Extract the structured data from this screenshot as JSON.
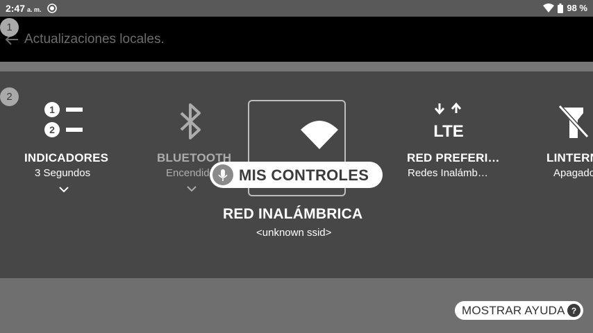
{
  "status_bar": {
    "time": "2:47",
    "ampm": "a. m.",
    "battery": "98 %"
  },
  "app_bar": {
    "title": "Actualizaciones locales."
  },
  "badges": [
    "1",
    "2"
  ],
  "controls": [
    {
      "label": "INDICADORES",
      "sub": "3 Segundos",
      "icon": "numbered-list-icon"
    },
    {
      "label": "BLUETOOTH",
      "sub": "Encendido",
      "icon": "bluetooth-icon"
    },
    {
      "label": "RED INALÁMBRICA",
      "sub": "<unknown ssid>",
      "icon": "wifi-icon"
    },
    {
      "label": "RED PREFERI…",
      "sub": "Redes Inalámb…",
      "icon": "lte-icon"
    },
    {
      "label": "LINTERNA",
      "sub": "Apagado",
      "icon": "flashlight-off-icon"
    }
  ],
  "overlay": {
    "title": "MIS CONTROLES"
  },
  "help_button": {
    "label": "MOSTRAR AYUDA",
    "glyph": "?"
  },
  "colors": {
    "panel": "#474747",
    "page": "#6f6f6f",
    "app_bar": "#000000",
    "status_bar": "#595959"
  }
}
